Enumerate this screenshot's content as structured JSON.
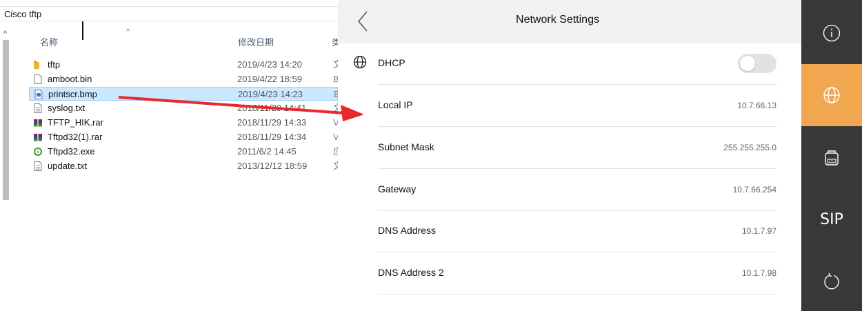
{
  "explorer": {
    "breadcrumb": "Cisco tftp",
    "columns": {
      "name": "名称",
      "date": "修改日期",
      "type": "类"
    },
    "files": [
      {
        "name": "tftp",
        "date": "2019/4/23 14:20",
        "extra": "文",
        "icon": "folder-icon",
        "selected": false
      },
      {
        "name": "amboot.bin",
        "date": "2019/4/22 18:59",
        "extra": "B",
        "icon": "file-icon",
        "selected": false
      },
      {
        "name": "printscr.bmp",
        "date": "2019/4/23 14:23",
        "extra": "B",
        "icon": "image-file-icon",
        "selected": true
      },
      {
        "name": "syslog.txt",
        "date": "2018/11/29 14:41",
        "extra": "文",
        "icon": "text-file-icon",
        "selected": false
      },
      {
        "name": "TFTP_HIK.rar",
        "date": "2018/11/29 14:33",
        "extra": "V",
        "icon": "archive-icon",
        "selected": false
      },
      {
        "name": "Tftpd32(1).rar",
        "date": "2018/11/29 14:34",
        "extra": "V",
        "icon": "archive-icon",
        "selected": false
      },
      {
        "name": "Tftpd32.exe",
        "date": "2011/6/2 14:45",
        "extra": "应",
        "icon": "exe-icon",
        "selected": false
      },
      {
        "name": "update.txt",
        "date": "2013/12/12 18:59",
        "extra": "文",
        "icon": "text-file-icon",
        "selected": false
      }
    ]
  },
  "settings": {
    "title": "Network Settings",
    "dhcp": {
      "label": "DHCP",
      "enabled": false
    },
    "rows": [
      {
        "label": "Local IP",
        "value": "10.7.66.13"
      },
      {
        "label": "Subnet Mask",
        "value": "255.255.255.0"
      },
      {
        "label": "Gateway",
        "value": "10.7.66.254"
      },
      {
        "label": "DNS Address",
        "value": "10.1.7.97"
      },
      {
        "label": "DNS Address 2",
        "value": "10.1.7.98"
      }
    ]
  },
  "sidebar": {
    "items": [
      {
        "icon": "info-icon",
        "active": false
      },
      {
        "icon": "globe-icon",
        "active": true
      },
      {
        "icon": "intercom-icon",
        "active": false
      },
      {
        "icon": "sip-icon",
        "label": "SIP",
        "active": false
      },
      {
        "icon": "restart-icon",
        "active": false
      }
    ]
  },
  "colors": {
    "accent": "#f1a650",
    "sidebar_bg": "#383838",
    "arrow": "#e8282b",
    "selection": "#cce8ff"
  }
}
